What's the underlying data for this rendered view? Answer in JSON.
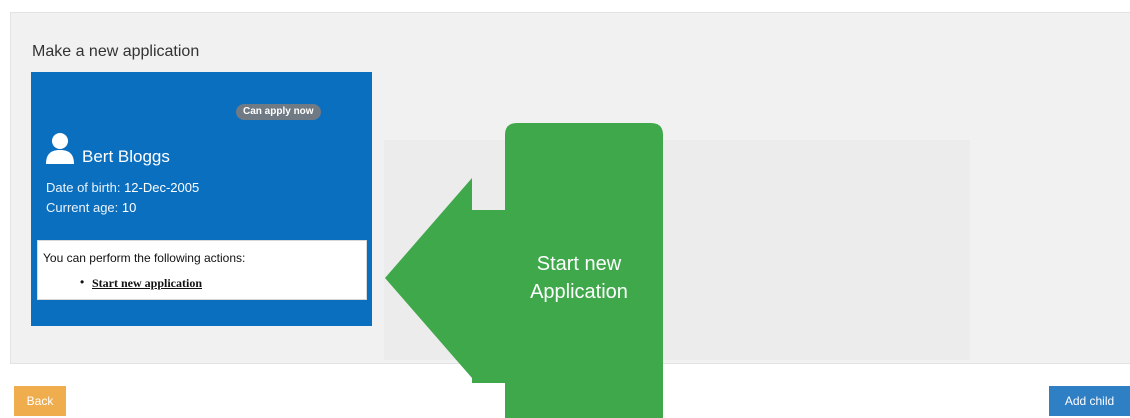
{
  "page": {
    "section_title": "Make a new application"
  },
  "child_card": {
    "status_badge": "Can apply now",
    "name": "Bert Bloggs",
    "dob_label": "Date of birth:",
    "dob_value": "12-Dec-2005",
    "age_label": "Current age:",
    "age_value": "10",
    "actions_heading": "You can perform the following actions:",
    "action_link": "Start new application",
    "colors": {
      "card": "#0b6fbf",
      "badge": "#6f7a84"
    },
    "icon": "user-icon"
  },
  "callout": {
    "text_line1": "Start new",
    "text_line2": "Application",
    "color": "#3ea84a",
    "icon": "left-arrow-callout"
  },
  "footer": {
    "back_label": "Back",
    "add_child_label": "Add child",
    "colors": {
      "back": "#f0ad4e",
      "add_child": "#2f7fc5"
    }
  }
}
